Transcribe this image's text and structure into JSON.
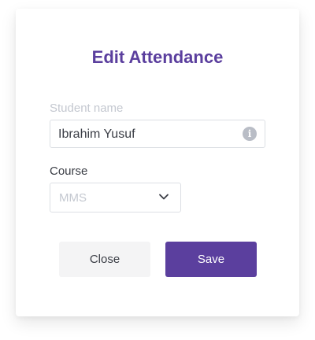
{
  "dialog": {
    "title": "Edit Attendance",
    "student_name": {
      "label": "Student name",
      "value": "Ibrahim Yusuf",
      "icon": "info-icon"
    },
    "course": {
      "label": "Course",
      "selected": "MMS",
      "icon": "chevron-down-icon"
    },
    "buttons": {
      "close_label": "Close",
      "save_label": "Save"
    }
  },
  "colors": {
    "accent": "#5b3f9e",
    "close_button_bg": "#f4f4f5",
    "placeholder_text": "#c4c8d0"
  }
}
